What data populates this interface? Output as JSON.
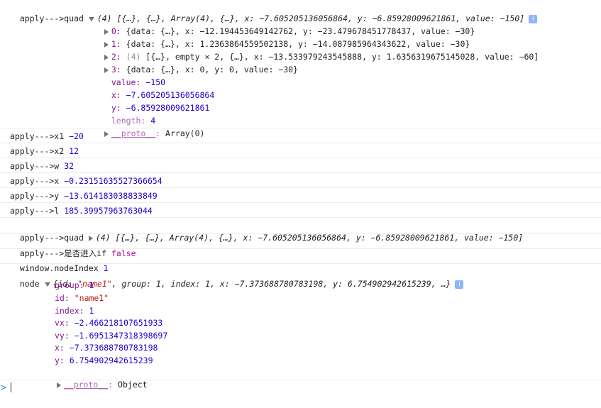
{
  "entries": {
    "quad1": {
      "label": "apply--->quad",
      "summary_count": "(4)",
      "summary": "[{…}, {…}, Array(4), {…}, x: −7.605205136056864, y: −6.85928009621861, value: −150]",
      "children": [
        {
          "key": "0:",
          "val": "{data: {…}, x: −12.194453649142762, y: −23.479678451778437, value: −30}"
        },
        {
          "key": "1:",
          "val": "{data: {…}, x: 1.2363864559502138, y: −14.087985964343622, value: −30}"
        },
        {
          "key": "2:",
          "count": "(4)",
          "val": "[{…}, empty × 2, {…}, x: −13.533979243545888, y: 1.6356319675145028, value: −60]"
        },
        {
          "key": "3:",
          "val": "{data: {…}, x: 0, y: 0, value: −30}"
        }
      ],
      "props": [
        {
          "key": "value:",
          "val": "−150"
        },
        {
          "key": "x:",
          "val": "−7.605205136056864"
        },
        {
          "key": "y:",
          "val": "−6.85928009621861"
        },
        {
          "key": "length:",
          "val": "4"
        }
      ],
      "proto_key": "__proto__",
      "proto_val": "Array(0)"
    },
    "simple": [
      {
        "label": "apply--->x1",
        "val": "−20"
      },
      {
        "label": "apply--->x2",
        "val": "12"
      },
      {
        "label": "apply--->w",
        "val": "32"
      },
      {
        "label": "apply--->x",
        "val": "−0.23151635527366654"
      },
      {
        "label": "apply--->y",
        "val": "−13.614183038833849"
      },
      {
        "label": "apply--->l",
        "val": "185.39957963763044"
      }
    ],
    "quad2": {
      "label": "apply--->quad",
      "summary_count": "(4)",
      "summary": "[{…}, {…}, Array(4), {…}, x: −7.605205136056864, y: −6.85928009621861, value: −150]"
    },
    "ifcheck": {
      "label": "apply--->是否进入if",
      "val": "false"
    },
    "nodeindex": {
      "label": "window.nodeIndex",
      "val": "1"
    },
    "node": {
      "label": "node",
      "summary_open": "{id: ",
      "summary_id": "\"name1\"",
      "summary_rest": ", group: 1, index: 1, x: −7.373688780783198, y: 6.754902942615239, …}",
      "props": [
        {
          "key": "group:",
          "val": "1",
          "type": "num"
        },
        {
          "key": "id:",
          "val": "\"name1\"",
          "type": "str"
        },
        {
          "key": "index:",
          "val": "1",
          "type": "num"
        },
        {
          "key": "vx:",
          "val": "−2.466218107651933",
          "type": "num"
        },
        {
          "key": "vy:",
          "val": "−1.6951347318398697",
          "type": "num"
        },
        {
          "key": "x:",
          "val": "−7.373688780783198",
          "type": "num"
        },
        {
          "key": "y:",
          "val": "6.754902942615239",
          "type": "num"
        }
      ],
      "proto_key": "__proto__",
      "proto_val": "Object"
    }
  },
  "info_icon_glyph": "i",
  "prompt_glyph": ">"
}
